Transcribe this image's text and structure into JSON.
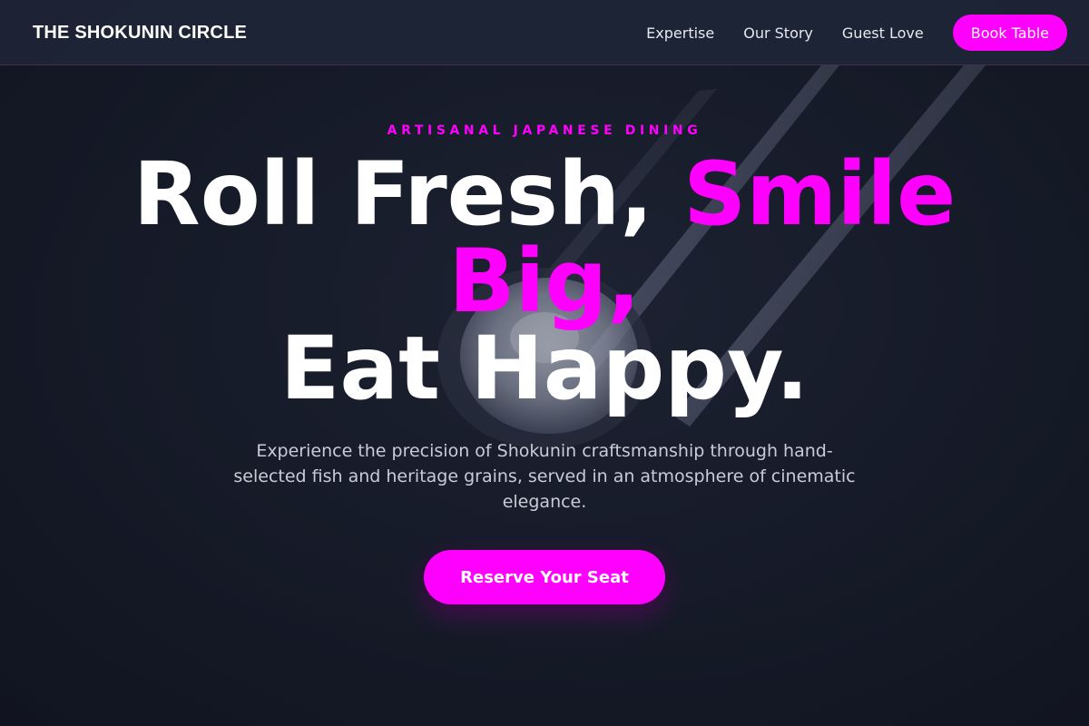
{
  "navbar": {
    "brand": "THE SHOKUNIN CIRCLE",
    "links": [
      {
        "label": "Expertise"
      },
      {
        "label": "Our Story"
      },
      {
        "label": "Guest Love"
      }
    ],
    "cta_label": "Book Table"
  },
  "hero": {
    "eyebrow": "ARTISANAL JAPANESE DINING",
    "headline": {
      "part1": "Roll Fresh, ",
      "accent": "Smile Big,",
      "part2": "Eat Happy."
    },
    "subtitle": "Experience the precision of Shokunin craftsmanship through hand-selected fish and heritage grains, served in an atmosphere of cinematic elegance.",
    "cta_label": "Reserve Your Seat",
    "background_image": "sushi-with-chopsticks-photo"
  },
  "colors": {
    "accent": "#ff00ff",
    "background": "#161b29",
    "navbar": "#1e2436",
    "text": "#ffffff",
    "muted_text": "#c9ccd6"
  }
}
